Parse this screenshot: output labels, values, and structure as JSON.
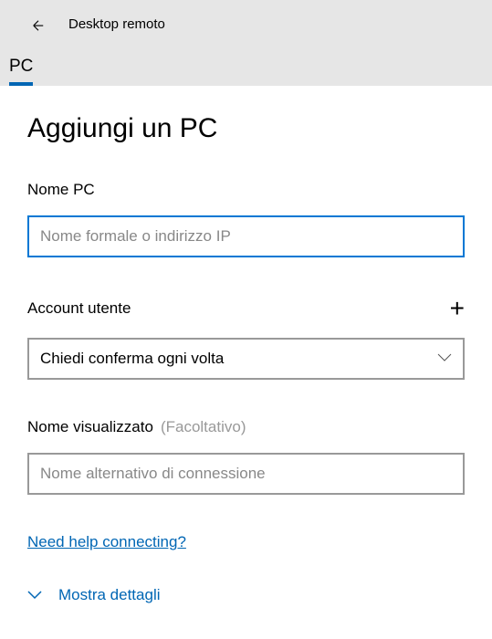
{
  "header": {
    "app_title": "Desktop remoto",
    "tab_label": "PC"
  },
  "page": {
    "title": "Aggiungi un PC"
  },
  "fields": {
    "pc_name": {
      "label": "Nome PC",
      "placeholder": "Nome formale o indirizzo IP",
      "value": ""
    },
    "user_account": {
      "label": "Account utente",
      "selected": "Chiedi conferma ogni volta"
    },
    "display_name": {
      "label": "Nome visualizzato",
      "optional_text": "(Facoltativo)",
      "placeholder": "Nome alternativo di connessione",
      "value": ""
    }
  },
  "links": {
    "help": "Need help connecting?",
    "show_details": "Mostra dettagli"
  }
}
